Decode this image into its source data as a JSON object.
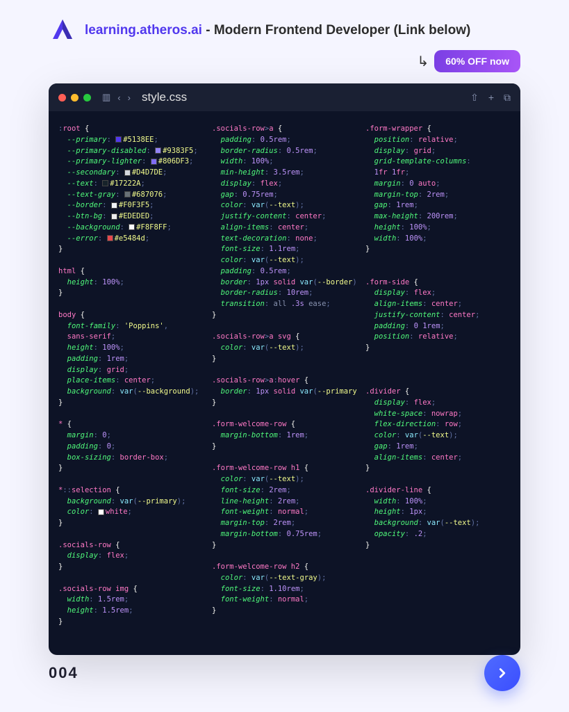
{
  "header": {
    "link": "learning.atheros.ai",
    "subtitle": " - Modern Frontend Developer (Link below)"
  },
  "promo": {
    "label": "60% OFF now"
  },
  "editor": {
    "filename": "style.css",
    "col1": [
      {
        "t": "rule",
        "sel": ":root",
        "decls": [
          {
            "p": "--primary",
            "v": "#5138EE",
            "sw": "#5138EE"
          },
          {
            "p": "--primary-disabled",
            "v": "#9383F5",
            "sw": "#9383F5"
          },
          {
            "p": "--primary-lighter",
            "v": "#806DF3",
            "sw": "#806DF3"
          },
          {
            "p": "--secondary",
            "v": "#D4D7DE",
            "sw": "#D4D7DE"
          },
          {
            "p": "--text",
            "v": "#17222A",
            "sw": "#17222A"
          },
          {
            "p": "--text-gray",
            "v": "#687076",
            "sw": "#687076"
          },
          {
            "p": "--border",
            "v": "#F0F3F5",
            "sw": "#F0F3F5"
          },
          {
            "p": "--btn-bg",
            "v": "#EDEDED",
            "sw": "#EDEDED"
          },
          {
            "p": "--background",
            "v": "#F8F8FF",
            "sw": "#F8F8FF"
          },
          {
            "p": "--error",
            "v": "#e5484d",
            "sw": "#e5484d"
          }
        ]
      },
      {
        "t": "rule",
        "sel": "html",
        "decls": [
          {
            "p": "height",
            "v": "100%"
          }
        ]
      },
      {
        "t": "rule",
        "sel": "body",
        "decls": [
          {
            "p": "font-family",
            "v": "'Poppins', sans-serif",
            "wrap": true
          },
          {
            "p": "height",
            "v": "100%"
          },
          {
            "p": "padding",
            "v": "1rem"
          },
          {
            "p": "display",
            "v": "grid"
          },
          {
            "p": "place-items",
            "v": "center"
          },
          {
            "p": "background",
            "v": "var(--background)"
          }
        ]
      },
      {
        "t": "rule",
        "sel": "*",
        "decls": [
          {
            "p": "margin",
            "v": "0"
          },
          {
            "p": "padding",
            "v": "0"
          },
          {
            "p": "box-sizing",
            "v": "border-box"
          }
        ]
      },
      {
        "t": "rule",
        "sel": "*::selection",
        "decls": [
          {
            "p": "background",
            "v": "var(--primary)"
          },
          {
            "p": "color",
            "v": "white",
            "sw": "#ffffff"
          }
        ]
      },
      {
        "t": "rule",
        "sel": ".socials-row",
        "decls": [
          {
            "p": "display",
            "v": "flex"
          }
        ]
      },
      {
        "t": "rule",
        "sel": ".socials-row img",
        "decls": [
          {
            "p": "width",
            "v": "1.5rem"
          },
          {
            "p": "height",
            "v": "1.5rem"
          }
        ]
      }
    ],
    "col2": [
      {
        "t": "rule",
        "sel": ".socials-row>a",
        "decls": [
          {
            "p": "padding",
            "v": "0.5rem"
          },
          {
            "p": "border-radius",
            "v": "0.5rem"
          },
          {
            "p": "width",
            "v": "100%"
          },
          {
            "p": "min-height",
            "v": "3.5rem"
          },
          {
            "p": "display",
            "v": "flex"
          },
          {
            "p": "gap",
            "v": "0.75rem"
          },
          {
            "p": "color",
            "v": "var(--text)"
          },
          {
            "p": "justify-content",
            "v": "center"
          },
          {
            "p": "align-items",
            "v": "center"
          },
          {
            "p": "text-decoration",
            "v": "none"
          },
          {
            "p": "font-size",
            "v": "1.1rem"
          },
          {
            "p": "color",
            "v": "var(--text)"
          },
          {
            "p": "padding",
            "v": "0.5rem"
          },
          {
            "p": "border",
            "v": "1px solid var(--border)"
          },
          {
            "p": "border-radius",
            "v": "10rem"
          },
          {
            "p": "transition",
            "v": "all .3s ease"
          }
        ]
      },
      {
        "t": "rule",
        "sel": ".socials-row>a svg",
        "decls": [
          {
            "p": "color",
            "v": "var(--text)"
          }
        ]
      },
      {
        "t": "rule",
        "sel": ".socials-row>a:hover",
        "decls": [
          {
            "p": "border",
            "v": "1px solid var(--primary)"
          }
        ]
      },
      {
        "t": "rule",
        "sel": ".form-welcome-row",
        "decls": [
          {
            "p": "margin-bottom",
            "v": "1rem"
          }
        ]
      },
      {
        "t": "rule",
        "sel": ".form-welcome-row h1",
        "decls": [
          {
            "p": "color",
            "v": "var(--text)"
          },
          {
            "p": "font-size",
            "v": "2rem"
          },
          {
            "p": "line-height",
            "v": "2rem"
          },
          {
            "p": "font-weight",
            "v": "normal"
          },
          {
            "p": "margin-top",
            "v": "2rem"
          },
          {
            "p": "margin-bottom",
            "v": "0.75rem"
          }
        ]
      },
      {
        "t": "rule",
        "sel": ".form-welcome-row h2",
        "decls": [
          {
            "p": "color",
            "v": "var(--text-gray)"
          },
          {
            "p": "font-size",
            "v": "1.10rem"
          },
          {
            "p": "font-weight",
            "v": "normal"
          }
        ]
      }
    ],
    "col3": [
      {
        "t": "rule",
        "sel": ".form-wrapper",
        "decls": [
          {
            "p": "position",
            "v": "relative"
          },
          {
            "p": "display",
            "v": "grid"
          },
          {
            "p": "grid-template-columns",
            "v": "1fr 1fr",
            "wrap": true
          },
          {
            "p": "margin",
            "v": "0 auto"
          },
          {
            "p": "margin-top",
            "v": "2rem"
          },
          {
            "p": "gap",
            "v": "1rem"
          },
          {
            "p": "max-height",
            "v": "200rem"
          },
          {
            "p": "height",
            "v": "100%"
          },
          {
            "p": "width",
            "v": "100%"
          }
        ]
      },
      {
        "t": "blank"
      },
      {
        "t": "rule",
        "sel": ".form-side",
        "decls": [
          {
            "p": "display",
            "v": "flex"
          },
          {
            "p": "align-items",
            "v": "center"
          },
          {
            "p": "justify-content",
            "v": "center"
          },
          {
            "p": "padding",
            "v": "0 1rem"
          },
          {
            "p": "position",
            "v": "relative"
          }
        ]
      },
      {
        "t": "blank"
      },
      {
        "t": "blank"
      },
      {
        "t": "rule",
        "sel": ".divider",
        "decls": [
          {
            "p": "display",
            "v": "flex"
          },
          {
            "p": "white-space",
            "v": "nowrap"
          },
          {
            "p": "flex-direction",
            "v": "row"
          },
          {
            "p": "color",
            "v": "var(--text)"
          },
          {
            "p": "gap",
            "v": "1rem"
          },
          {
            "p": "align-items",
            "v": "center"
          }
        ]
      },
      {
        "t": "rule",
        "sel": ".divider-line",
        "decls": [
          {
            "p": "width",
            "v": "100%"
          },
          {
            "p": "height",
            "v": "1px"
          },
          {
            "p": "background",
            "v": "var(--text)"
          },
          {
            "p": "opacity",
            "v": ".2"
          }
        ]
      }
    ]
  },
  "footer": {
    "page": "004"
  }
}
